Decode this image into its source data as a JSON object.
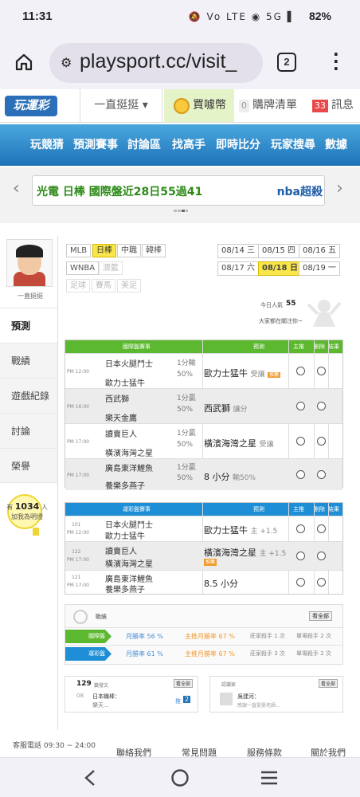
{
  "status": {
    "time": "11:31",
    "icons": "🔕 Vo LTE ◉ 5G ▌",
    "battery": "82%"
  },
  "browser": {
    "url": "playsport.cc/visit_",
    "tab_count": "2"
  },
  "site_header": {
    "logo": "玩運彩",
    "user": "一直挺挺 ▾",
    "buy": "買噱幣",
    "cart_count": "0",
    "cart": "購牌清單",
    "msg_count": "33",
    "msg": "訊息"
  },
  "nav": [
    "玩競猜",
    "預測賽事",
    "討論區",
    "找高手",
    "即時比分",
    "玩家搜尋",
    "數據"
  ],
  "ticker": {
    "left": "光電 日棒 國際盤近28日55過41",
    "right": "nba超殺"
  },
  "profile": {
    "name": "一直挺挺"
  },
  "side_tabs": [
    "預測",
    "戰績",
    "遊戲紀錄",
    "討論",
    "榮譽"
  ],
  "bulb": {
    "prefix": "有",
    "count": "1034",
    "suffix": "人",
    "line2": "加我為明燈"
  },
  "leagues": {
    "row1": [
      "MLB",
      "日棒",
      "中職",
      "韓棒"
    ],
    "row2": [
      "WNBA",
      "澳籃"
    ],
    "row3": [
      "足球",
      "賽馬",
      "美足"
    ],
    "active": "日棒"
  },
  "dates": {
    "row1": [
      "08/14 三",
      "08/15 四",
      "08/16 五"
    ],
    "row2": [
      "08/17 六",
      "08/18 日",
      "08/19 一"
    ],
    "active": "08/18 日"
  },
  "popularity": {
    "label": "今日人氣",
    "value": "55",
    "line2": "大家都在關注你~"
  },
  "table1": {
    "header": [
      "國際盤賽事",
      "預測",
      "主推",
      "刪除",
      "結果"
    ],
    "rows": [
      {
        "time": "PM 12:00",
        "t1": "日本火腿鬥士",
        "t2": "歐力士猛牛",
        "odds1": "1分輸",
        "odds2": "50%",
        "pick": "歐力士猛牛",
        "pick_note": "受讓",
        "badge": "推薦"
      },
      {
        "time": "PM 16:00",
        "t1": "西武獅",
        "t2": "樂天金鷹",
        "odds1": "1分贏",
        "odds2": "50%",
        "pick": "西武獅",
        "pick_note": "讓分",
        "badge": ""
      },
      {
        "time": "PM 17:00",
        "t1": "讀賣巨人",
        "t2": "橫濱海灣之星",
        "odds1": "1分贏",
        "odds2": "50%",
        "pick": "橫濱海灣之星",
        "pick_note": "受讓",
        "badge": ""
      },
      {
        "time": "PM 17:00",
        "t1": "廣島東洋鯉魚",
        "t2": "養樂多燕子",
        "odds1": "1分贏",
        "odds2": "50%",
        "pick": "8 小分",
        "pick_note": "輸50%",
        "badge": ""
      }
    ]
  },
  "table2": {
    "header": [
      "運彩盤賽事",
      "預測",
      "主推",
      "刪除",
      "結果"
    ],
    "rows": [
      {
        "num": "101",
        "time": "PM 12:00",
        "t1": "日本火腿鬥士",
        "t2": "歐力士猛牛",
        "pick": "歐力士猛牛",
        "pick_note": "主 +1.5",
        "badge": ""
      },
      {
        "num": "122",
        "time": "PM 17:00",
        "t1": "讀賣巨人",
        "t2": "橫濱海灣之星",
        "pick": "橫濱海灣之星",
        "pick_note": "主 +1.5",
        "badge": "推薦"
      },
      {
        "num": "121",
        "time": "PM 17:00",
        "t1": "廣島東洋鯉魚",
        "t2": "養樂多燕子",
        "pick": "8.5 小分",
        "pick_note": "",
        "badge": ""
      }
    ]
  },
  "stats": {
    "title": "戰績",
    "more": "看全部",
    "rows": [
      {
        "label": "國際盤",
        "rate": "月勝率 56",
        "main": "主推月勝率 67",
        "rank": "莊家殺手 1",
        "single": "單場殺手 2"
      },
      {
        "label": "運彩盤",
        "rate": "月勝率 61",
        "main": "主推月勝率 67",
        "rank": "莊家殺手 3",
        "single": "單場殺手 2"
      }
    ],
    "unit_pct": "%",
    "unit_times": "次"
  },
  "post_box": {
    "count": "129",
    "count_label": "篇發文",
    "more": "看全部",
    "date": "08",
    "team": "日本職棒：",
    "author": "樂天...",
    "tag": "推",
    "tag_count": "2"
  },
  "fan_box": {
    "title": "認識家",
    "more": "看全部",
    "name": "吳建河：",
    "desc": "感謝一直挺挺老師..."
  },
  "footer": {
    "service": "客服電話 09:30 ~ 24:00",
    "links": [
      "聯絡我們",
      "常見問題",
      "服務條款",
      "關於我們"
    ]
  },
  "colors": {
    "nav": "#1e72b8",
    "green_header": "#5cb82f",
    "blue_header": "#1e8fd6",
    "active": "#f9e64a"
  }
}
